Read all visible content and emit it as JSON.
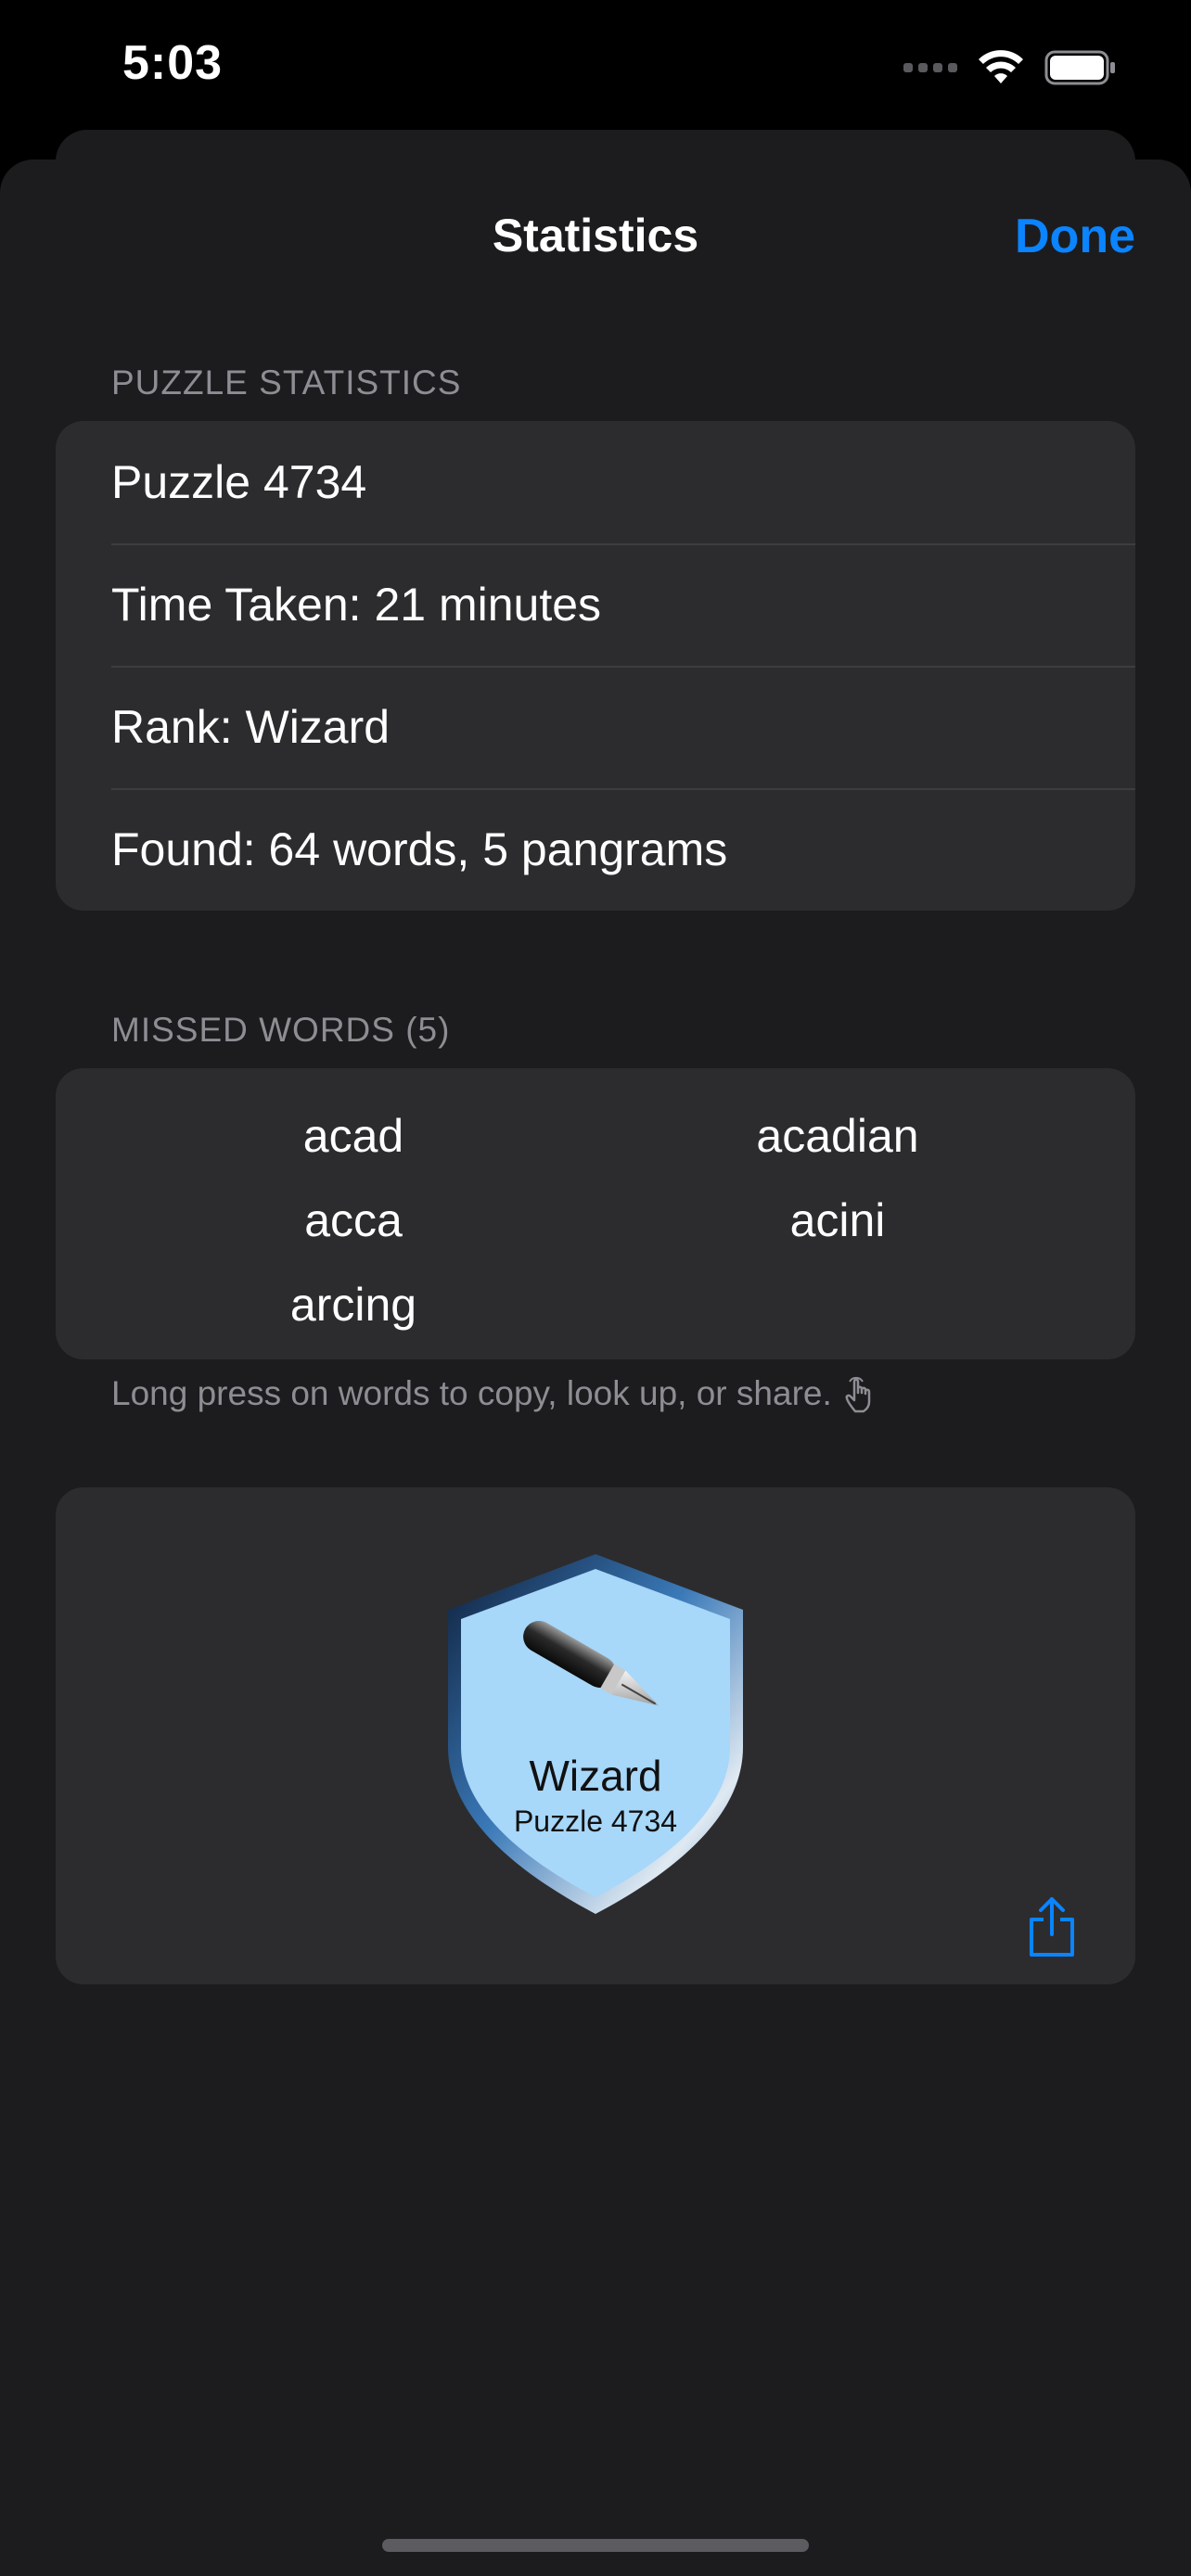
{
  "status_bar": {
    "time": "5:03",
    "signal_icon": "cellular-signal-icon",
    "wifi_icon": "wifi-icon",
    "battery_icon": "battery-icon"
  },
  "nav": {
    "title": "Statistics",
    "done_label": "Done"
  },
  "puzzle_statistics": {
    "header": "PUZZLE STATISTICS",
    "rows": [
      "Puzzle 4734",
      "Time Taken: 21 minutes",
      "Rank: Wizard",
      "Found: 64 words, 5 pangrams"
    ]
  },
  "missed_words": {
    "header": "MISSED WORDS (5)",
    "words": [
      "acad",
      "acadian",
      "acca",
      "acini",
      "arcing"
    ],
    "footer": "Long press on words to copy, look up, or share.",
    "footer_icon": "hand-point-icon"
  },
  "badge": {
    "rank": "Wizard",
    "puzzle": "Puzzle 4734",
    "icon": "fountain-pen-icon",
    "share_icon": "share-icon"
  },
  "colors": {
    "accent": "#0a84ff",
    "sheet_background": "#1c1c1e",
    "group_background": "#2c2c2e",
    "badge_fill": "#a7d7f9"
  }
}
